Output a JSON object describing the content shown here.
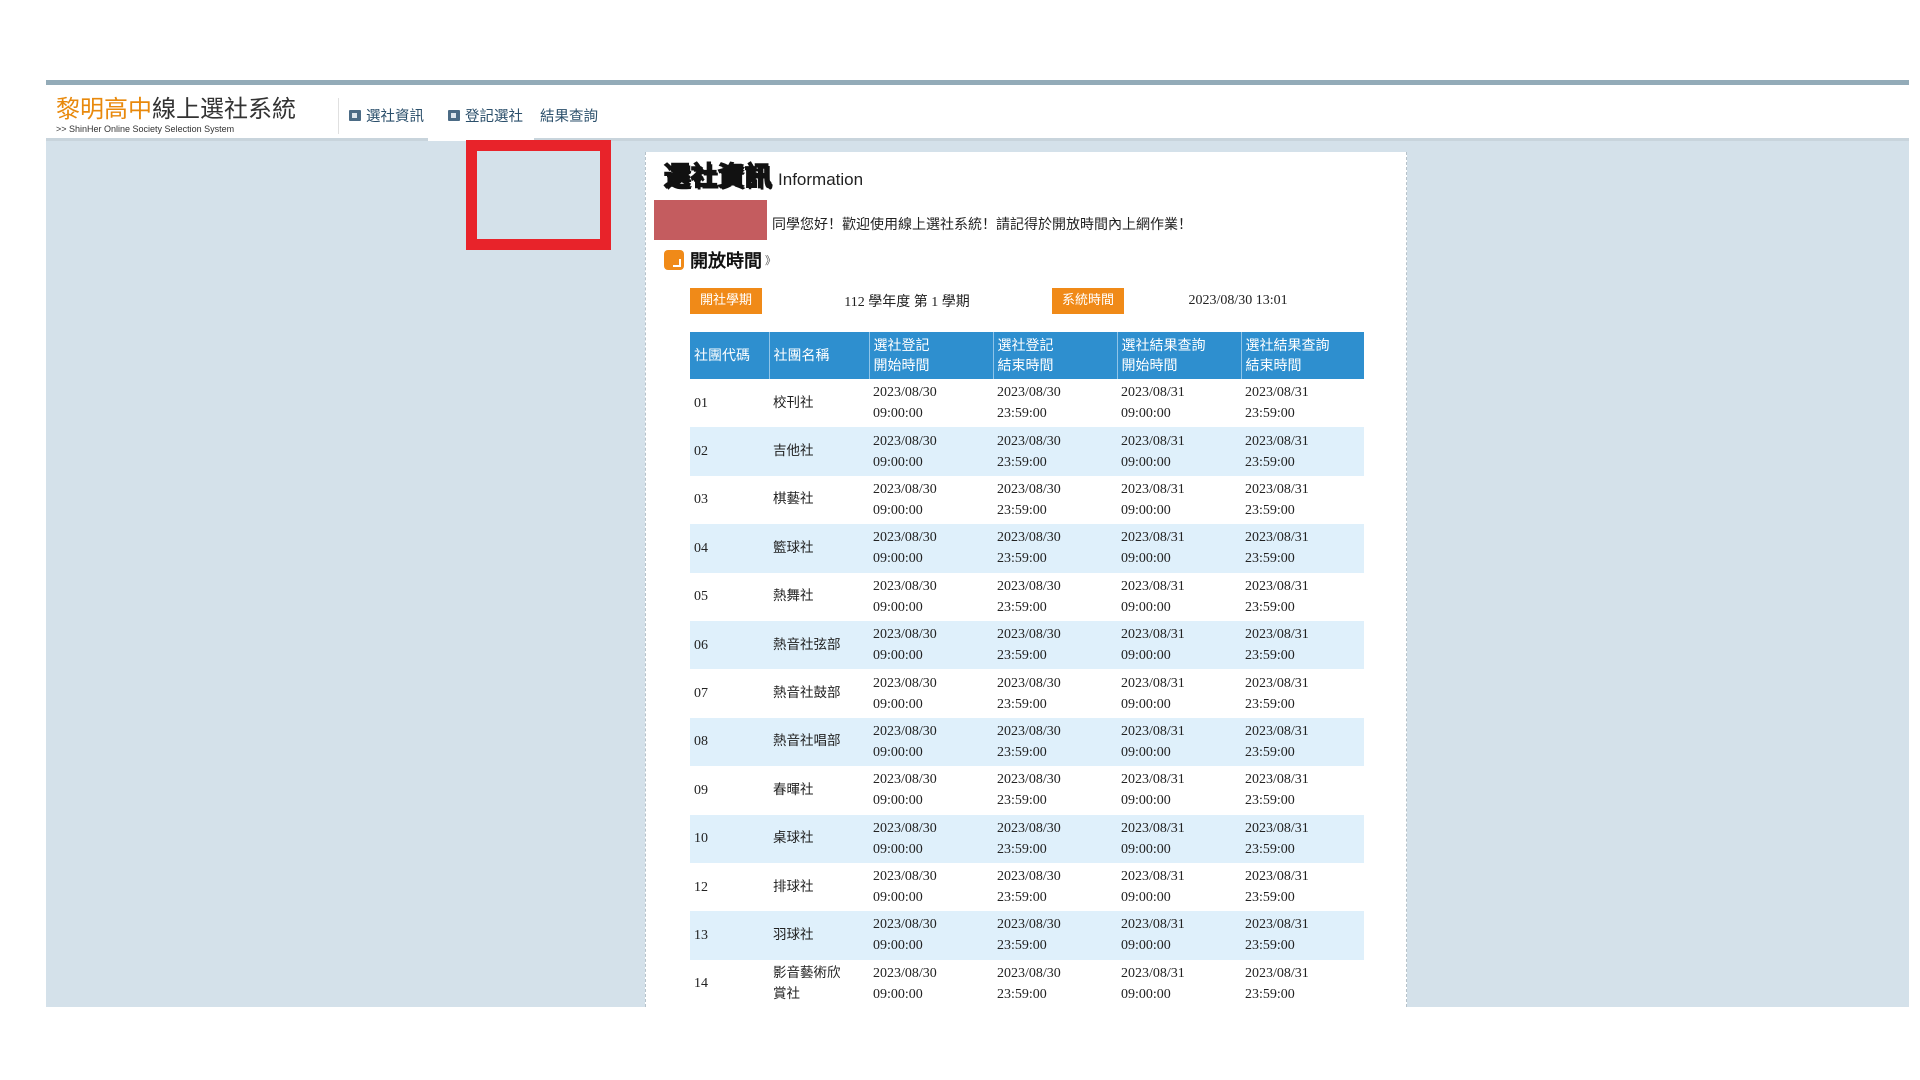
{
  "header": {
    "logo_orange": "黎明高中",
    "logo_dark": "線上選社系統",
    "logo_subtitle": ">> ShinHer Online Society Selection System",
    "nav": [
      {
        "label": "選社資訊",
        "icon": "document-icon"
      },
      {
        "label": "登記選社",
        "icon": "document-icon"
      },
      {
        "label": "結果查詢"
      }
    ]
  },
  "page": {
    "title": "選社資訊",
    "title_en": "Information",
    "welcome": "同學您好！歡迎使用線上選社系統！請記得於開放時間內上網作業！",
    "section_title": "開放時間",
    "section_mark": "》",
    "term_label": "開社學期",
    "term_value": "112 學年度 第 1 學期",
    "systime_label": "系統時間",
    "systime_value": "2023/08/30 13:01"
  },
  "table": {
    "headers": [
      "社團代碼",
      "社團名稱",
      "選社登記\n開始時間",
      "選社登記\n結束時間",
      "選社結果查詢\n開始時間",
      "選社結果查詢\n結束時間"
    ],
    "rows": [
      [
        "01",
        "校刊社",
        "2023/08/30\n09:00:00",
        "2023/08/30\n23:59:00",
        "2023/08/31\n09:00:00",
        "2023/08/31\n23:59:00"
      ],
      [
        "02",
        "吉他社",
        "2023/08/30\n09:00:00",
        "2023/08/30\n23:59:00",
        "2023/08/31\n09:00:00",
        "2023/08/31\n23:59:00"
      ],
      [
        "03",
        "棋藝社",
        "2023/08/30\n09:00:00",
        "2023/08/30\n23:59:00",
        "2023/08/31\n09:00:00",
        "2023/08/31\n23:59:00"
      ],
      [
        "04",
        "籃球社",
        "2023/08/30\n09:00:00",
        "2023/08/30\n23:59:00",
        "2023/08/31\n09:00:00",
        "2023/08/31\n23:59:00"
      ],
      [
        "05",
        "熱舞社",
        "2023/08/30\n09:00:00",
        "2023/08/30\n23:59:00",
        "2023/08/31\n09:00:00",
        "2023/08/31\n23:59:00"
      ],
      [
        "06",
        "熱音社弦部",
        "2023/08/30\n09:00:00",
        "2023/08/30\n23:59:00",
        "2023/08/31\n09:00:00",
        "2023/08/31\n23:59:00"
      ],
      [
        "07",
        "熱音社鼓部",
        "2023/08/30\n09:00:00",
        "2023/08/30\n23:59:00",
        "2023/08/31\n09:00:00",
        "2023/08/31\n23:59:00"
      ],
      [
        "08",
        "熱音社唱部",
        "2023/08/30\n09:00:00",
        "2023/08/30\n23:59:00",
        "2023/08/31\n09:00:00",
        "2023/08/31\n23:59:00"
      ],
      [
        "09",
        "春暉社",
        "2023/08/30\n09:00:00",
        "2023/08/30\n23:59:00",
        "2023/08/31\n09:00:00",
        "2023/08/31\n23:59:00"
      ],
      [
        "10",
        "桌球社",
        "2023/08/30\n09:00:00",
        "2023/08/30\n23:59:00",
        "2023/08/31\n09:00:00",
        "2023/08/31\n23:59:00"
      ],
      [
        "12",
        "排球社",
        "2023/08/30\n09:00:00",
        "2023/08/30\n23:59:00",
        "2023/08/31\n09:00:00",
        "2023/08/31\n23:59:00"
      ],
      [
        "13",
        "羽球社",
        "2023/08/30\n09:00:00",
        "2023/08/30\n23:59:00",
        "2023/08/31\n09:00:00",
        "2023/08/31\n23:59:00"
      ],
      [
        "14",
        "影音藝術欣\n賞社",
        "2023/08/30\n09:00:00",
        "2023/08/30\n23:59:00",
        "2023/08/31\n09:00:00",
        "2023/08/31\n23:59:00"
      ]
    ]
  },
  "colors": {
    "accent_orange": "#f08a18",
    "header_blue": "#2e8fcf",
    "row_stripe": "#dff0fb",
    "annotation_red": "#e8232a",
    "background": "#d4e1ea"
  }
}
